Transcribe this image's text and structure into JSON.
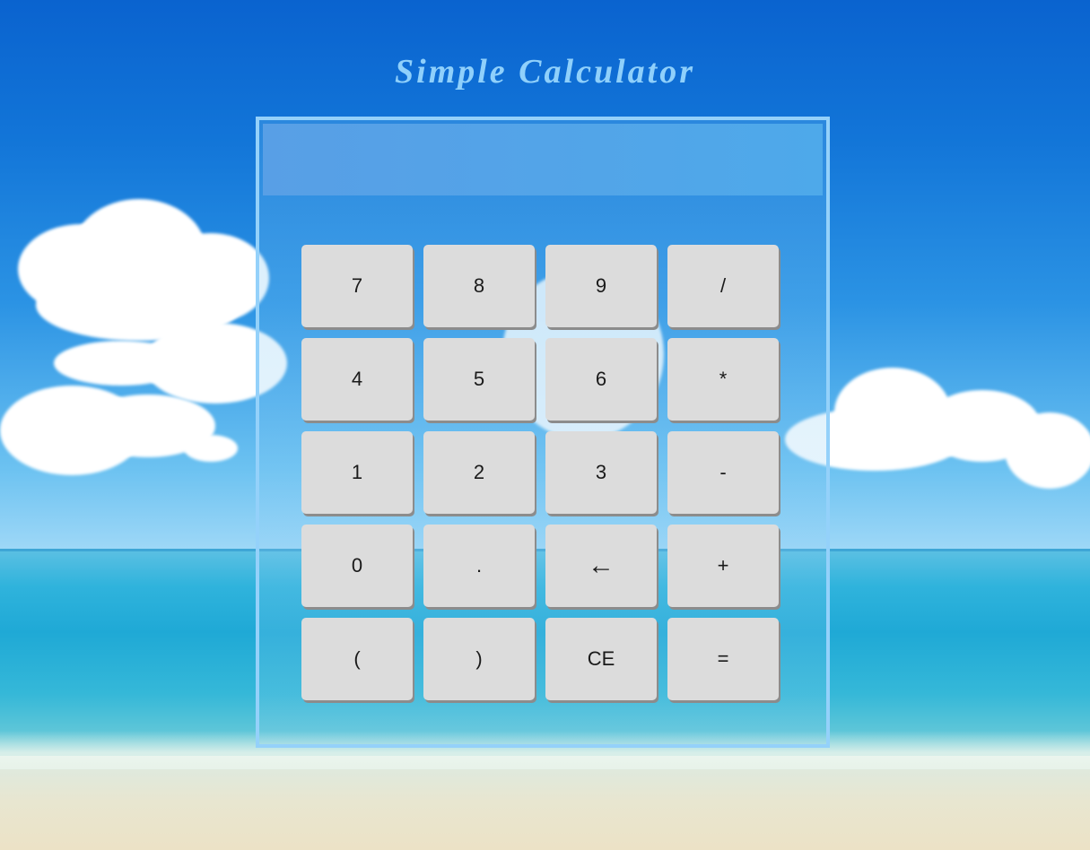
{
  "app": {
    "title": "Simple Calculator"
  },
  "display": {
    "value": ""
  },
  "keys": [
    {
      "label": "7",
      "name": "key-7"
    },
    {
      "label": "8",
      "name": "key-8"
    },
    {
      "label": "9",
      "name": "key-9"
    },
    {
      "label": "/",
      "name": "key-divide"
    },
    {
      "label": "4",
      "name": "key-4"
    },
    {
      "label": "5",
      "name": "key-5"
    },
    {
      "label": "6",
      "name": "key-6"
    },
    {
      "label": "*",
      "name": "key-multiply"
    },
    {
      "label": "1",
      "name": "key-1"
    },
    {
      "label": "2",
      "name": "key-2"
    },
    {
      "label": "3",
      "name": "key-3"
    },
    {
      "label": "-",
      "name": "key-subtract"
    },
    {
      "label": "0",
      "name": "key-0"
    },
    {
      "label": ".",
      "name": "key-decimal"
    },
    {
      "label": "←",
      "name": "key-backspace"
    },
    {
      "label": "+",
      "name": "key-add"
    },
    {
      "label": "(",
      "name": "key-open-paren"
    },
    {
      "label": ")",
      "name": "key-close-paren"
    },
    {
      "label": "CE",
      "name": "key-clear-entry"
    },
    {
      "label": "=",
      "name": "key-equals"
    }
  ],
  "colors": {
    "title": "#8fd0fb",
    "frame": "#94d1fa",
    "display": "#4ea9ea",
    "key_face": "#dcdcdc",
    "key_shadow": "#8c8c8c"
  }
}
